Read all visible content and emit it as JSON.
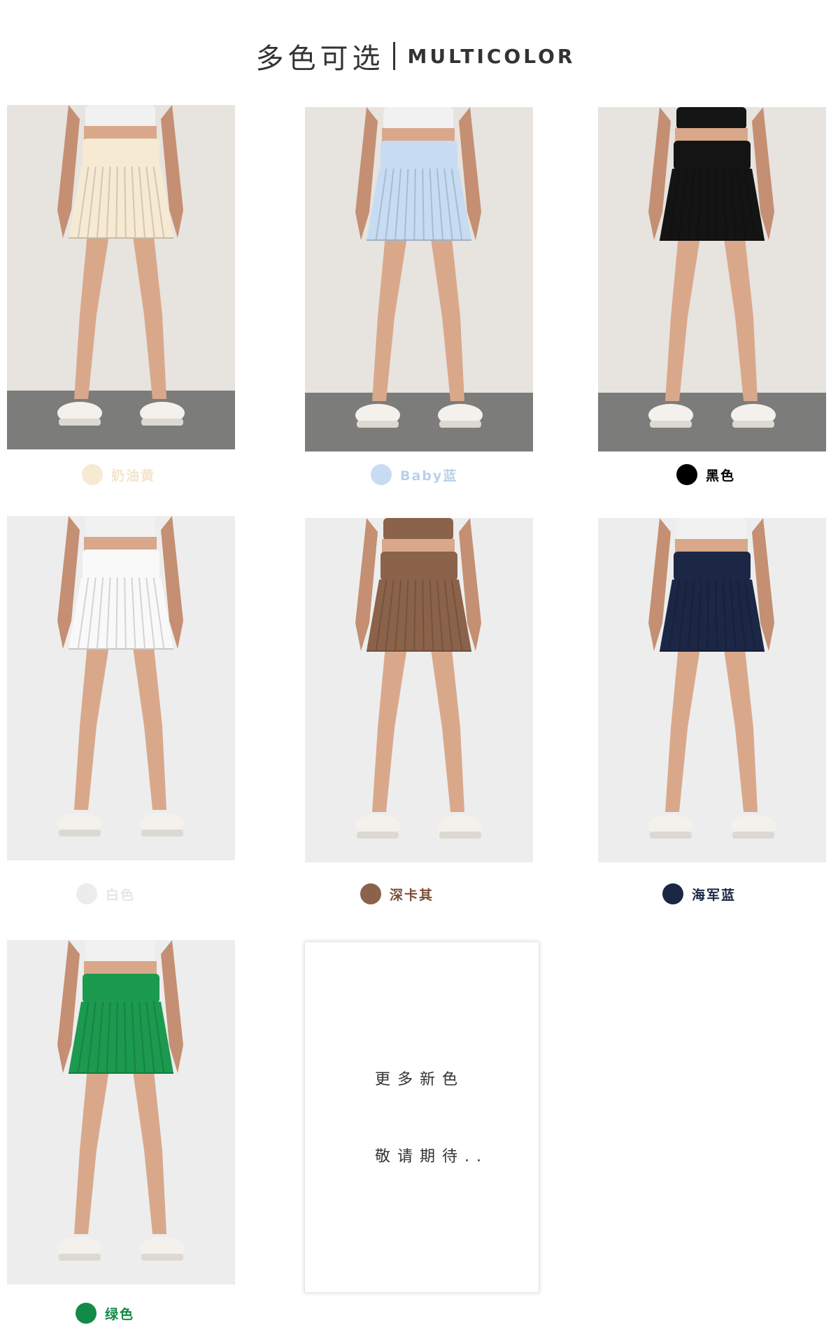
{
  "header": {
    "title_cn": "多色可选",
    "title_en": "MULTICOLOR"
  },
  "products": [
    {
      "label": "奶油黄",
      "skirt_color": "#f7ead2",
      "label_color": "#f3e4cd",
      "dot_color": "#f7ead2",
      "bg": "#e7e3df",
      "floor": "#7c7c7a"
    },
    {
      "label": "Baby蓝",
      "skirt_color": "#c7dcf2",
      "label_color": "#b8d1ec",
      "dot_color": "#c7dcf2",
      "bg": "#e7e3df",
      "floor": "#7c7c7a"
    },
    {
      "label": "黑色",
      "skirt_color": "#141414",
      "label_color": "#000000",
      "dot_color": "#000000",
      "bg": "#e7e3df",
      "floor": "#7c7c7a"
    },
    {
      "label": "白色",
      "skirt_color": "#f9f9f9",
      "label_color": "#e6e6e6",
      "dot_color": "#ececec",
      "bg": "#ededed",
      "floor": "#ededed"
    },
    {
      "label": "深卡其",
      "skirt_color": "#8b624a",
      "label_color": "#7a5038",
      "dot_color": "#8b624a",
      "bg": "#ededed",
      "floor": "#ededed"
    },
    {
      "label": "海军蓝",
      "skirt_color": "#1b2745",
      "label_color": "#1b2745",
      "dot_color": "#1b2745",
      "bg": "#ededed",
      "floor": "#ededed"
    },
    {
      "label": "绿色",
      "skirt_color": "#1c9a4f",
      "label_color": "#138a46",
      "dot_color": "#138a46",
      "bg": "#ededed",
      "floor": "#ededed"
    }
  ],
  "more": {
    "line1": "更多新色",
    "line2": "敬请期待.."
  }
}
